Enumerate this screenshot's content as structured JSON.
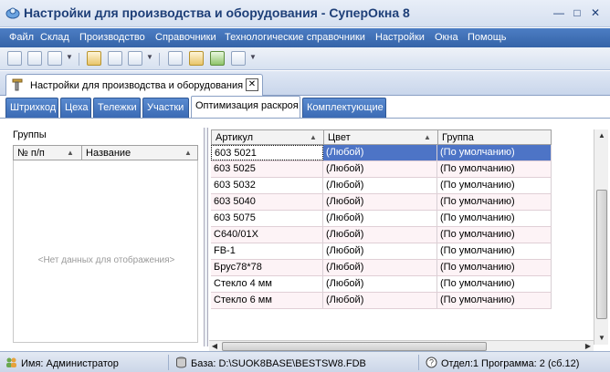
{
  "window": {
    "title": "Настройки для производства и оборудования - СуперОкна 8",
    "controls": [
      "—",
      "□",
      "✕"
    ]
  },
  "menu": [
    "Файл",
    "Склад",
    "Производство",
    "Справочники",
    "Технологические справочники",
    "Настройки",
    "Окна",
    "Помощь"
  ],
  "toolbar": {
    "icons": [
      "new-doc-icon",
      "add-doc-icon",
      "print-icon",
      "filter-icon",
      "copy-icon",
      "paste-icon",
      "report-icon",
      "doc-gold-icon",
      "doc-green-icon",
      "doc-settings-icon"
    ]
  },
  "doc_tab": {
    "label": "Настройки для производства и оборудования",
    "close": "✕"
  },
  "settings_tabs": [
    "Штрихкод",
    "Цеха",
    "Тележки",
    "Участки",
    "Оптимизация раскроя",
    "Комплектующие"
  ],
  "left_panel": {
    "title": "Группы",
    "columns": [
      "№ п/п",
      "Название"
    ],
    "empty_text": "<Нет данных для отображения>"
  },
  "grid": {
    "columns": [
      "Артикул",
      "Цвет",
      "Группа"
    ],
    "rows": [
      [
        "603 5021",
        "(Любой)",
        "(По умолчанию)"
      ],
      [
        "603 5025",
        "(Любой)",
        "(По умолчанию)"
      ],
      [
        "603 5032",
        "(Любой)",
        "(По умолчанию)"
      ],
      [
        "603 5040",
        "(Любой)",
        "(По умолчанию)"
      ],
      [
        "603 5075",
        "(Любой)",
        "(По умолчанию)"
      ],
      [
        "C640/01X",
        "(Любой)",
        "(По умолчанию)"
      ],
      [
        "FB-1",
        "(Любой)",
        "(По умолчанию)"
      ],
      [
        "Брус78*78",
        "(Любой)",
        "(По умолчанию)"
      ],
      [
        "Стекло 4 мм",
        "(Любой)",
        "(По умолчанию)"
      ],
      [
        "Стекло 6 мм",
        "(Любой)",
        "(По умолчанию)"
      ]
    ]
  },
  "status": {
    "user": "Имя: Администратор",
    "db": "База: D:\\SUOK8BASE\\BESTSW8.FDB",
    "dept": "Отдел:1 Программа: 2 (сб.12)"
  }
}
